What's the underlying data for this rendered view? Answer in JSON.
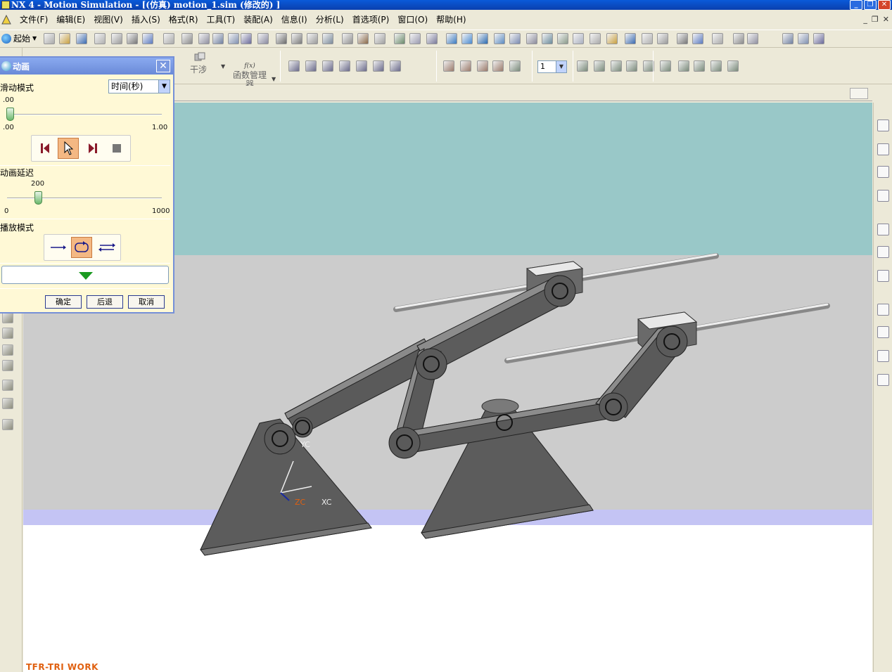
{
  "window": {
    "title": "NX 4 - Motion Simulation - [(仿真) motion_1.sim  (修改的) ]",
    "minimize": "_",
    "restore": "❐",
    "close": "✕"
  },
  "menubar": {
    "items": [
      "文件(F)",
      "编辑(E)",
      "视图(V)",
      "插入(S)",
      "格式(R)",
      "工具(T)",
      "装配(A)",
      "信息(I)",
      "分析(L)",
      "首选项(P)",
      "窗口(O)",
      "帮助(H)"
    ],
    "mdi_minimize": "_",
    "mdi_restore": "❐",
    "mdi_close": "✕"
  },
  "toolbar": {
    "start_label": "起始",
    "interference_label": "干涉",
    "function_manager_fx": "f(x)",
    "function_manager_label": "函数管理器",
    "layer_value": "1"
  },
  "dialog": {
    "title": "动画",
    "close": "✕",
    "slide_mode_label": "滑动模式",
    "slide_mode_value": "时间(秒)",
    "time_current": ".00",
    "time_min": ".00",
    "time_max": "1.00",
    "delay_label": "动画延迟",
    "delay_value": "200",
    "delay_min": "0",
    "delay_max": "1000",
    "delay_fraction": 0.2,
    "playback_label": "播放模式",
    "ok": "确定",
    "back": "后退",
    "cancel": "取消"
  },
  "viewport": {
    "axis_yc": "YC",
    "axis_zc": "ZC",
    "axis_xc": "XC",
    "watermark": "TFR-TRI WORK",
    "colors": {
      "background_teal": "#99c8c8",
      "floor_grey": "#cccccc",
      "part_grey": "#606060",
      "stripe_lavender": "#c4c4f4",
      "watermark_orange": "#e06010"
    }
  }
}
